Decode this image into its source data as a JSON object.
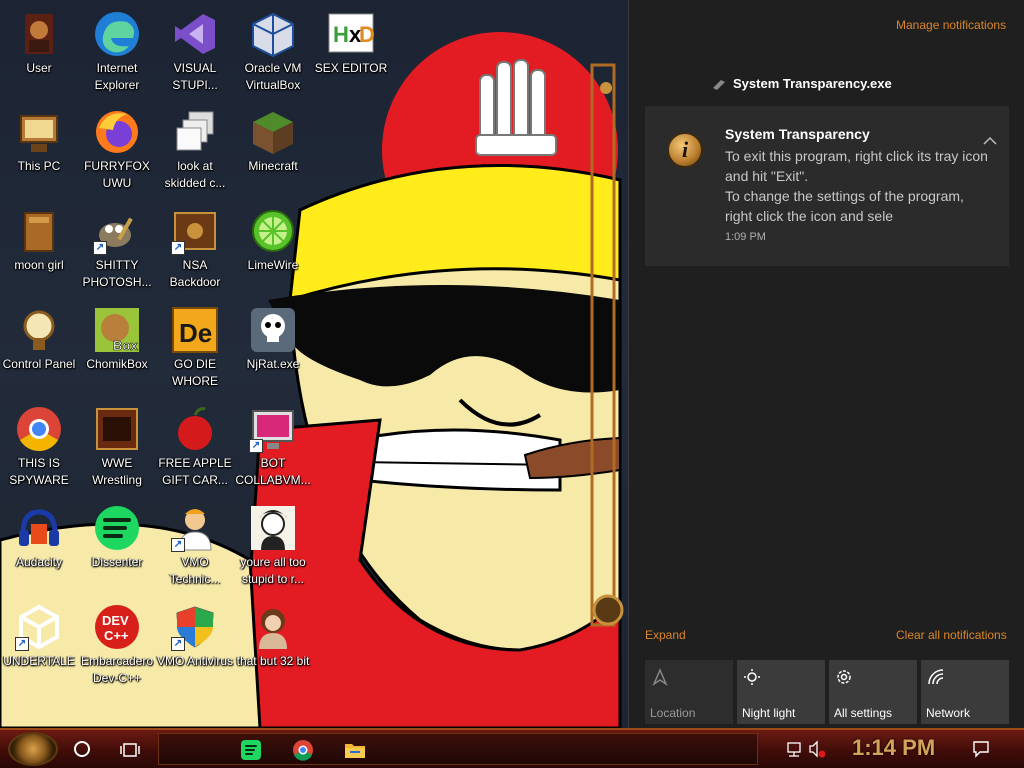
{
  "desktop": {
    "icons": [
      {
        "label": "User",
        "icon": "user-avatar-icon"
      },
      {
        "label": "Internet Explorer",
        "icon": "edge-icon"
      },
      {
        "label": "VISUAL STUPI...",
        "icon": "visual-studio-icon"
      },
      {
        "label": "Oracle VM VirtualBox",
        "icon": "virtualbox-icon"
      },
      {
        "label": "SEX EDITOR",
        "icon": "hxd-icon"
      },
      {
        "label": "This PC",
        "icon": "computer-icon"
      },
      {
        "label": "FURRYFOX UWU",
        "icon": "firefox-icon"
      },
      {
        "label": "look at skidded c...",
        "icon": "windows-stack-icon"
      },
      {
        "label": "Minecraft",
        "icon": "grass-block-icon"
      },
      {
        "label": "moon girl",
        "icon": "folder-icon"
      },
      {
        "label": "SHITTY PHOTOSH...",
        "icon": "gimp-icon"
      },
      {
        "label": "NSA Backdoor",
        "icon": "brass-box-icon"
      },
      {
        "label": "LimeWire",
        "icon": "limewire-icon"
      },
      {
        "label": "Control Panel",
        "icon": "control-panel-icon"
      },
      {
        "label": "ChomikBox",
        "icon": "chomikbox-icon"
      },
      {
        "label": "GO DIE WHORE",
        "icon": "de-icon"
      },
      {
        "label": "NjRat.exe",
        "icon": "skull-icon"
      },
      {
        "label": "THIS IS SPYWARE",
        "icon": "chrome-icon"
      },
      {
        "label": "WWE Wrestling",
        "icon": "wwe-icon"
      },
      {
        "label": "FREE APPLE GIFT CAR...",
        "icon": "apple-icon"
      },
      {
        "label": "BOT COLLABVM...",
        "icon": "monitor-icon"
      },
      {
        "label": "Audacity",
        "icon": "audacity-icon"
      },
      {
        "label": "Dissenter",
        "icon": "dissenter-icon"
      },
      {
        "label": "VMO Technic...",
        "icon": "technician-icon"
      },
      {
        "label": "youre all too stupid to r...",
        "icon": "portrait-icon"
      },
      {
        "label": "UNDERTALE",
        "icon": "unity-icon"
      },
      {
        "label": "Embarcadero Dev-C++",
        "icon": "devcpp-icon"
      },
      {
        "label": "VMO Antivirus",
        "icon": "shield-icon"
      },
      {
        "label": "that but 32 bit",
        "icon": "portrait-lady-icon"
      }
    ]
  },
  "action_center": {
    "manage_label": "Manage notifications",
    "app_name": "System Transparency.exe",
    "notification": {
      "title": "System Transparency",
      "body": "To exit this program, right click its tray icon and hit \"Exit\".\nTo change the settings of the program, right click the icon and sele",
      "time": "1:09 PM"
    },
    "expand_label": "Expand",
    "clear_label": "Clear all notifications",
    "tiles": [
      {
        "label": "Location",
        "icon": "location-icon",
        "active": false
      },
      {
        "label": "Night light",
        "icon": "brightness-icon",
        "active": true
      },
      {
        "label": "All settings",
        "icon": "gear-icon",
        "active": true
      },
      {
        "label": "Network",
        "icon": "network-icon",
        "active": true
      }
    ]
  },
  "taskbar": {
    "clock": "1:14 PM",
    "pinned": [
      "spotify-icon",
      "chrome-icon",
      "file-explorer-icon"
    ]
  },
  "colors": {
    "accent": "#d9862a",
    "taskbar": "#4a1009",
    "clock": "#d3a35a"
  }
}
